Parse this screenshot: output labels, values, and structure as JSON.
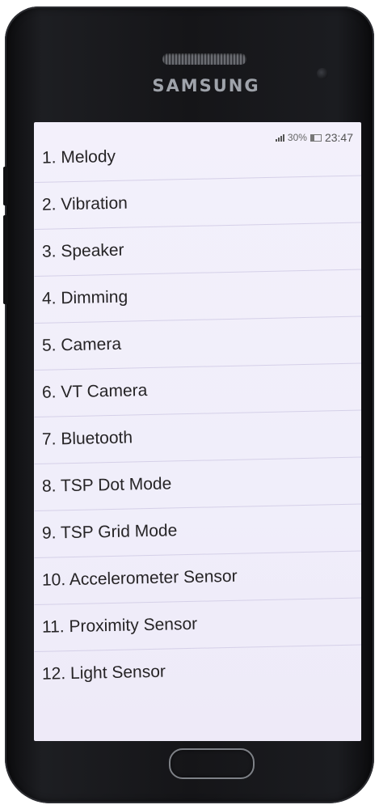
{
  "device": {
    "brand": "SAMSUNG"
  },
  "status_bar": {
    "signal_percent": "30%",
    "time": "23:47"
  },
  "menu": {
    "items": [
      {
        "label": "1. Melody"
      },
      {
        "label": "2. Vibration"
      },
      {
        "label": "3. Speaker"
      },
      {
        "label": "4. Dimming"
      },
      {
        "label": "5. Camera"
      },
      {
        "label": "6. VT Camera"
      },
      {
        "label": "7. Bluetooth"
      },
      {
        "label": "8. TSP Dot Mode"
      },
      {
        "label": "9. TSP Grid Mode"
      },
      {
        "label": "10. Accelerometer Sensor"
      },
      {
        "label": "11. Proximity Sensor"
      },
      {
        "label": "12. Light Sensor"
      }
    ]
  }
}
